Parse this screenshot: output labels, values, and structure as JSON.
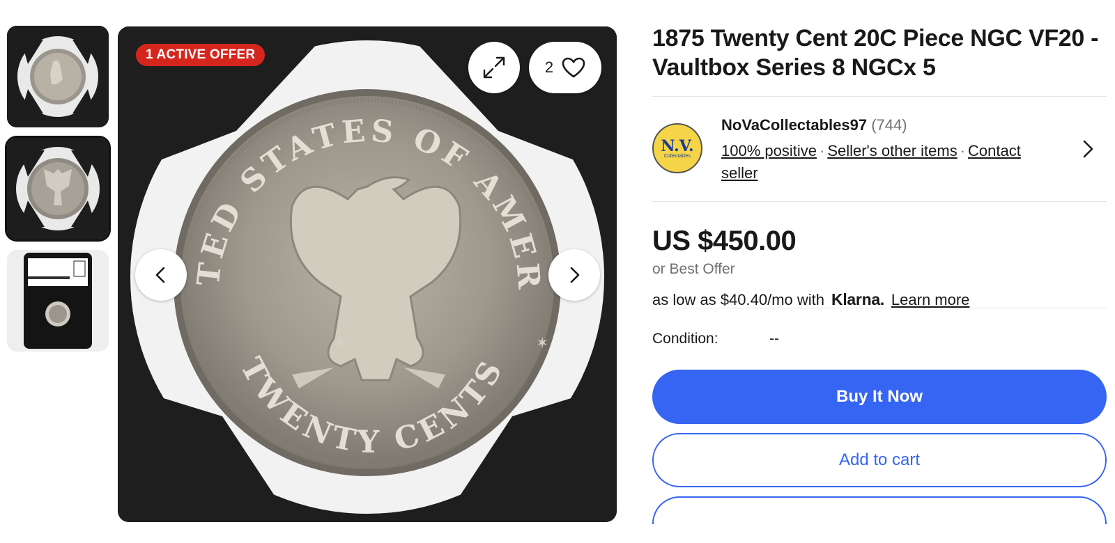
{
  "gallery": {
    "offer_badge": "1 ACTIVE OFFER",
    "favorite_count": "2",
    "thumbnails": [
      {
        "alt": "obverse"
      },
      {
        "alt": "reverse",
        "selected": true
      },
      {
        "alt": "slab"
      }
    ],
    "coin_text_top": "UNITED STATES OF AMERICA",
    "coin_text_bottom": "TWENTY CENTS",
    "thumb_slab_label": "1875 20C",
    "thumb_slab_sub": "Vaultbox Series 8",
    "thumb_slab_grade": "5"
  },
  "listing": {
    "title": "1875 Twenty Cent 20C Piece NGC VF20 - Vaultbox Series 8 NGCx 5"
  },
  "seller": {
    "logo_text": "N.V.",
    "logo_sub": "Collectables",
    "name": "NoVaCollectables97",
    "feedback_count": "(744)",
    "positive": "100% positive",
    "other_items": "Seller's other items",
    "contact": "Contact seller"
  },
  "pricing": {
    "price": "US $450.00",
    "best_offer": "or Best Offer",
    "klarna_prefix": "as low as $40.40/mo with",
    "klarna_logo": "Klarna.",
    "learn_more": "Learn more"
  },
  "details": {
    "condition_label": "Condition:",
    "condition_value": "--"
  },
  "actions": {
    "buy_now": "Buy It Now",
    "add_to_cart": "Add to cart"
  },
  "colors": {
    "primary": "#3665f3",
    "badge": "#d5261e"
  }
}
